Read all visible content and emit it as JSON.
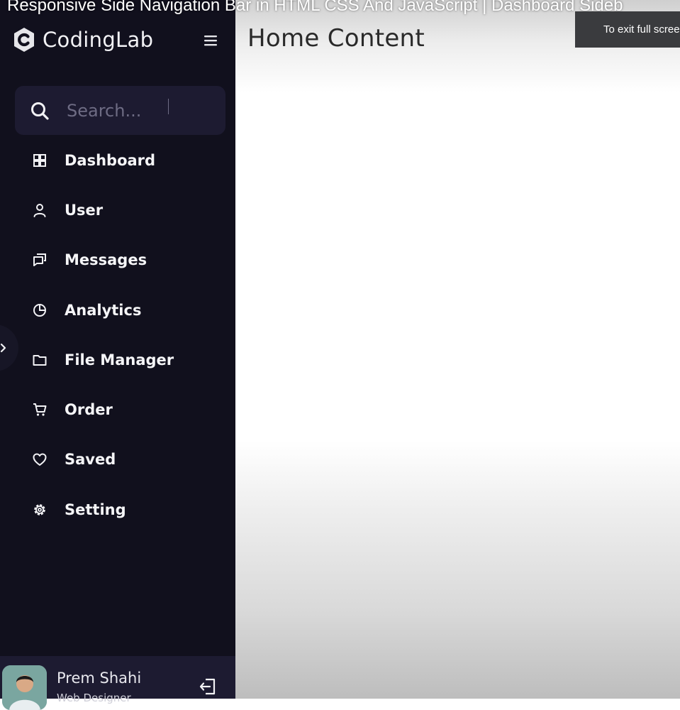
{
  "video": {
    "title": "Responsive Side Navigation Bar in HTML CSS And JavaScript | Dashboard Sideb",
    "fullscreen_hint": "To exit full screen"
  },
  "sidebar": {
    "brand": "CodingLab",
    "search": {
      "placeholder": "Search..."
    },
    "items": [
      {
        "label": "Dashboard",
        "icon": "grid-icon"
      },
      {
        "label": "User",
        "icon": "user-icon"
      },
      {
        "label": "Messages",
        "icon": "chat-icon"
      },
      {
        "label": "Analytics",
        "icon": "pie-chart-icon"
      },
      {
        "label": "File Manager",
        "icon": "folder-icon"
      },
      {
        "label": "Order",
        "icon": "cart-icon"
      },
      {
        "label": "Saved",
        "icon": "heart-icon"
      },
      {
        "label": "Setting",
        "icon": "gear-icon"
      }
    ],
    "profile": {
      "name": "Prem Shahi",
      "role": "Web Designer"
    }
  },
  "main": {
    "title": "Home Content"
  },
  "colors": {
    "sidebar_bg": "#11101d",
    "search_bg": "#1d1b31",
    "content_bg": "#ffffff"
  }
}
